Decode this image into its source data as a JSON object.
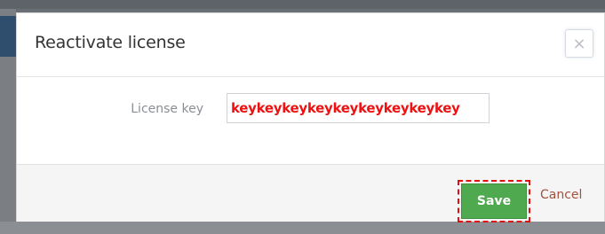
{
  "modal": {
    "title": "Reactivate license",
    "close_label": "×"
  },
  "form": {
    "license_key_label": "License key",
    "license_key_value": "keykeykeykeykeykeykeykeykey"
  },
  "footer": {
    "save_label": "Save",
    "cancel_label": "Cancel"
  },
  "colors": {
    "save_button": "#4fa94e",
    "input_text": "#ee1111",
    "cancel_link": "#a0523f",
    "highlight_outline": "#e01010"
  }
}
